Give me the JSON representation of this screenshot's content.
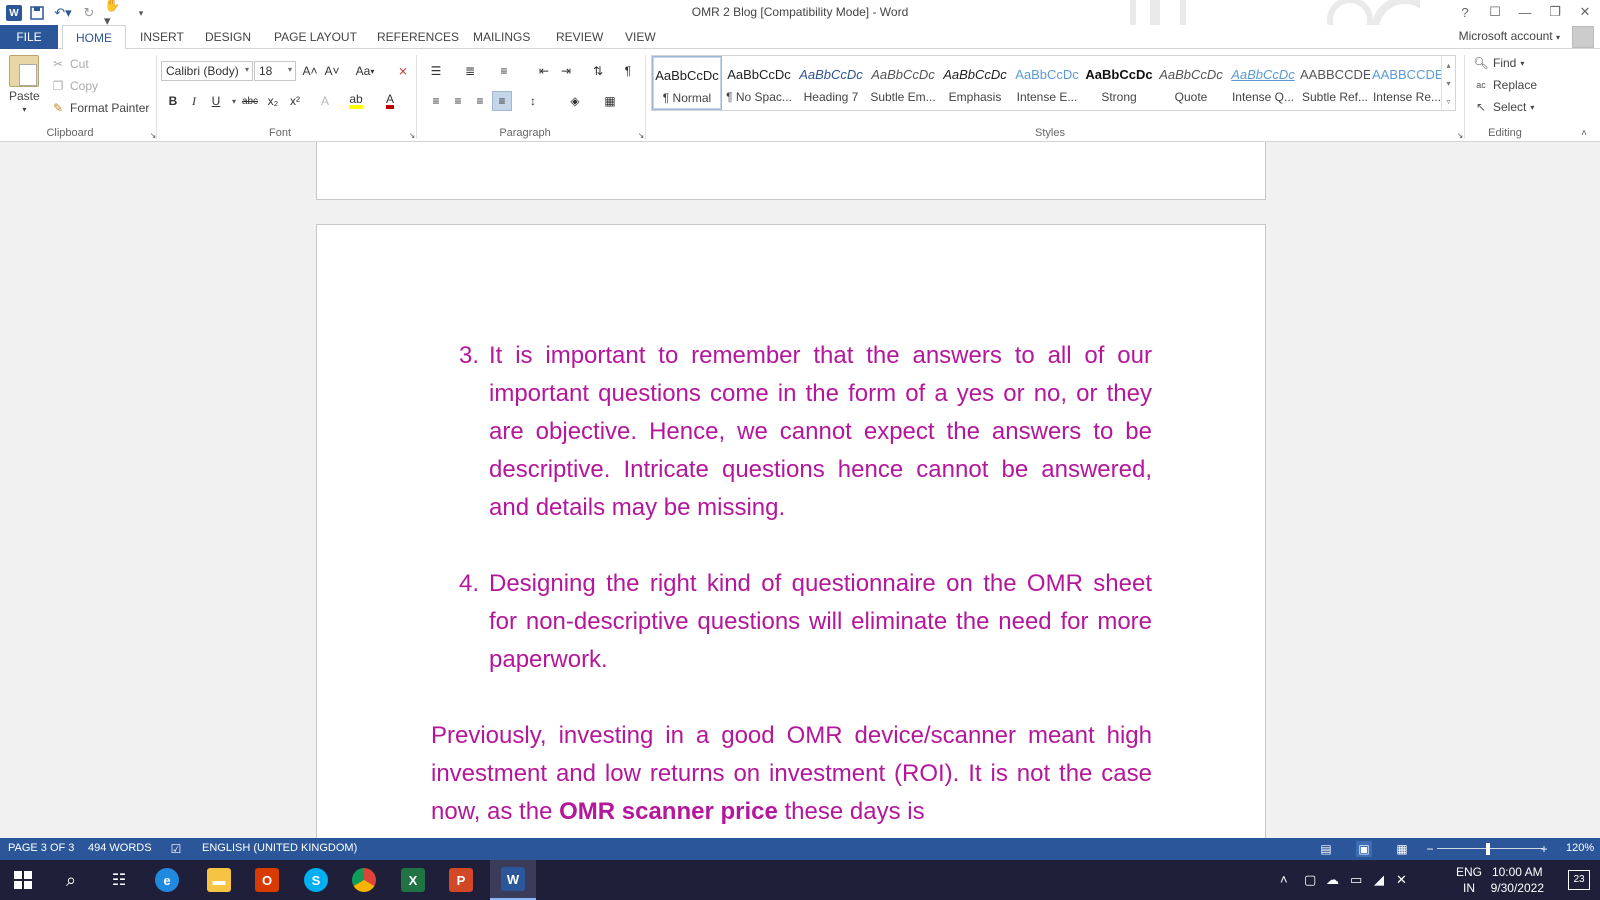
{
  "titlebar": {
    "title": "OMR 2 Blog [Compatibility Mode] - Word",
    "help": "?",
    "ribbon_display": "☐",
    "minimize": "—",
    "restore": "❐",
    "close": "✕"
  },
  "tabs": {
    "file": "FILE",
    "home": "HOME",
    "insert": "INSERT",
    "design": "DESIGN",
    "page_layout": "PAGE LAYOUT",
    "references": "REFERENCES",
    "mailings": "MAILINGS",
    "review": "REVIEW",
    "view": "VIEW",
    "account": "Microsoft account"
  },
  "clipboard": {
    "paste": "Paste",
    "cut": "Cut",
    "copy": "Copy",
    "format_painter": "Format Painter",
    "label": "Clipboard"
  },
  "font": {
    "name": "Calibri (Body)",
    "size": "18",
    "label": "Font",
    "grow": "A˄",
    "shrink": "A˅",
    "change_case": "Aa",
    "bold": "B",
    "italic": "I",
    "underline": "U",
    "strike": "abc",
    "subscript": "x₂",
    "superscript": "x²"
  },
  "paragraph": {
    "label": "Paragraph"
  },
  "styles": {
    "label": "Styles",
    "items": [
      {
        "preview": "AaBbCcDc",
        "name": "¶ Normal",
        "color": "#222222"
      },
      {
        "preview": "AaBbCcDc",
        "name": "¶ No Spac...",
        "color": "#222222"
      },
      {
        "preview": "AaBbCcDc",
        "name": "Heading 7",
        "color": "#2f5496"
      },
      {
        "preview": "AaBbCcDc",
        "name": "Subtle Em...",
        "color": "#555555"
      },
      {
        "preview": "AaBbCcDc",
        "name": "Emphasis",
        "color": "#222222"
      },
      {
        "preview": "AaBbCcDc",
        "name": "Intense E...",
        "color": "#5b9bd5"
      },
      {
        "preview": "AaBbCcDc",
        "name": "Strong",
        "color": "#111111"
      },
      {
        "preview": "AaBbCcDc",
        "name": "Quote",
        "color": "#555555"
      },
      {
        "preview": "AaBbCcDc",
        "name": "Intense Q...",
        "color": "#5b9bd5"
      },
      {
        "preview": "AABBCCDE",
        "name": "Subtle Ref...",
        "color": "#555555"
      },
      {
        "preview": "AABBCCDE",
        "name": "Intense Re...",
        "color": "#5b9bd5"
      }
    ]
  },
  "editing": {
    "find": "Find",
    "replace": "Replace",
    "select": "Select",
    "label": "Editing"
  },
  "document": {
    "text_color": "#b4179b",
    "item3_num": "3.",
    "item3_text": "It is important to remember that the answers to all of our important questions come in the form of a yes or no, or they are objective. Hence, we cannot expect the answers to be descriptive. Intricate questions hence cannot be answered, and details may be missing.",
    "item4_num": "4.",
    "item4_text": "Designing the right kind of questionnaire on the OMR sheet for non-descriptive questions will eliminate the need for more paperwork.",
    "para_before": "Previously, investing in a good OMR device/scanner meant high investment and low returns on investment (ROI). It is not the case now, as the ",
    "para_bold": "OMR scanner price",
    "para_after": " these days is"
  },
  "statusbar": {
    "page": "PAGE 3 OF 3",
    "words": "494 WORDS",
    "language": "ENGLISH (UNITED KINGDOM)",
    "zoom": "120%",
    "zoom_level_percent": 120
  },
  "taskbar": {
    "lang_line1": "ENG",
    "lang_line2": "IN",
    "time": "10:00 AM",
    "date": "9/30/2022",
    "notification_count": "23"
  }
}
